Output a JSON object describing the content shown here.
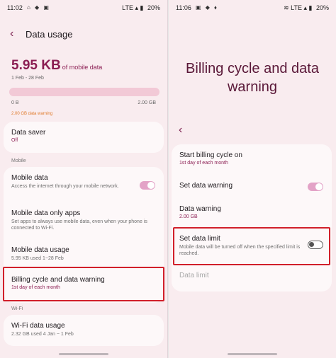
{
  "left": {
    "status": {
      "time": "11:02",
      "icons": "⌂ ◆ ▣",
      "right_icons": "LTE ▴ ▮",
      "battery": "20%"
    },
    "title": "Data usage",
    "usage_value": "5.95 KB",
    "usage_suffix": "of mobile data",
    "date_range": "1 Feb - 28 Feb",
    "usage_fraction": 0.0,
    "axis_min": "0 B",
    "axis_max": "2.00 GB",
    "warning_label": "2.00 GB data warning",
    "data_saver": {
      "title": "Data saver",
      "value": "Off"
    },
    "section_mobile": "Mobile",
    "mobile_data": {
      "title": "Mobile data",
      "desc": "Access the internet through your mobile network.",
      "toggle_on": true
    },
    "mobile_data_only_apps": {
      "title": "Mobile data only apps",
      "desc": "Set apps to always use mobile data, even when your phone is connected to Wi-Fi."
    },
    "mobile_data_usage": {
      "title": "Mobile data usage",
      "desc": "5.95 KB used 1−28 Feb"
    },
    "billing": {
      "title": "Billing cycle and data warning",
      "value": "1st day of each month"
    },
    "section_wifi": "Wi-Fi",
    "wifi_usage": {
      "title": "Wi-Fi data usage",
      "desc": "2.32 GB used 4 Jan − 1 Feb"
    }
  },
  "right": {
    "status": {
      "time": "11:06",
      "icons": "▣ ◆ ⬧",
      "right_icons": "≋ LTE ▴ ▮",
      "battery": "20%"
    },
    "title": "Billing cycle and data warning",
    "start_cycle": {
      "title": "Start billing cycle on",
      "value": "1st day of each month"
    },
    "set_warning": {
      "title": "Set data warning",
      "toggle_on": true
    },
    "data_warning": {
      "title": "Data warning",
      "value": "2.00 GB"
    },
    "set_limit": {
      "title": "Set data limit",
      "desc": "Mobile data will be turned off when the specified limit is reached.",
      "toggle_on": false
    },
    "data_limit": {
      "title": "Data limit"
    }
  },
  "colors": {
    "accent": "#8b1d52",
    "highlight": "#d11f2a",
    "toggle_on": "#e3a3c7",
    "background": "#f9ecef"
  },
  "icons": [
    "back-arrow-icon",
    "wifi-icon",
    "signal-icon",
    "battery-icon"
  ]
}
